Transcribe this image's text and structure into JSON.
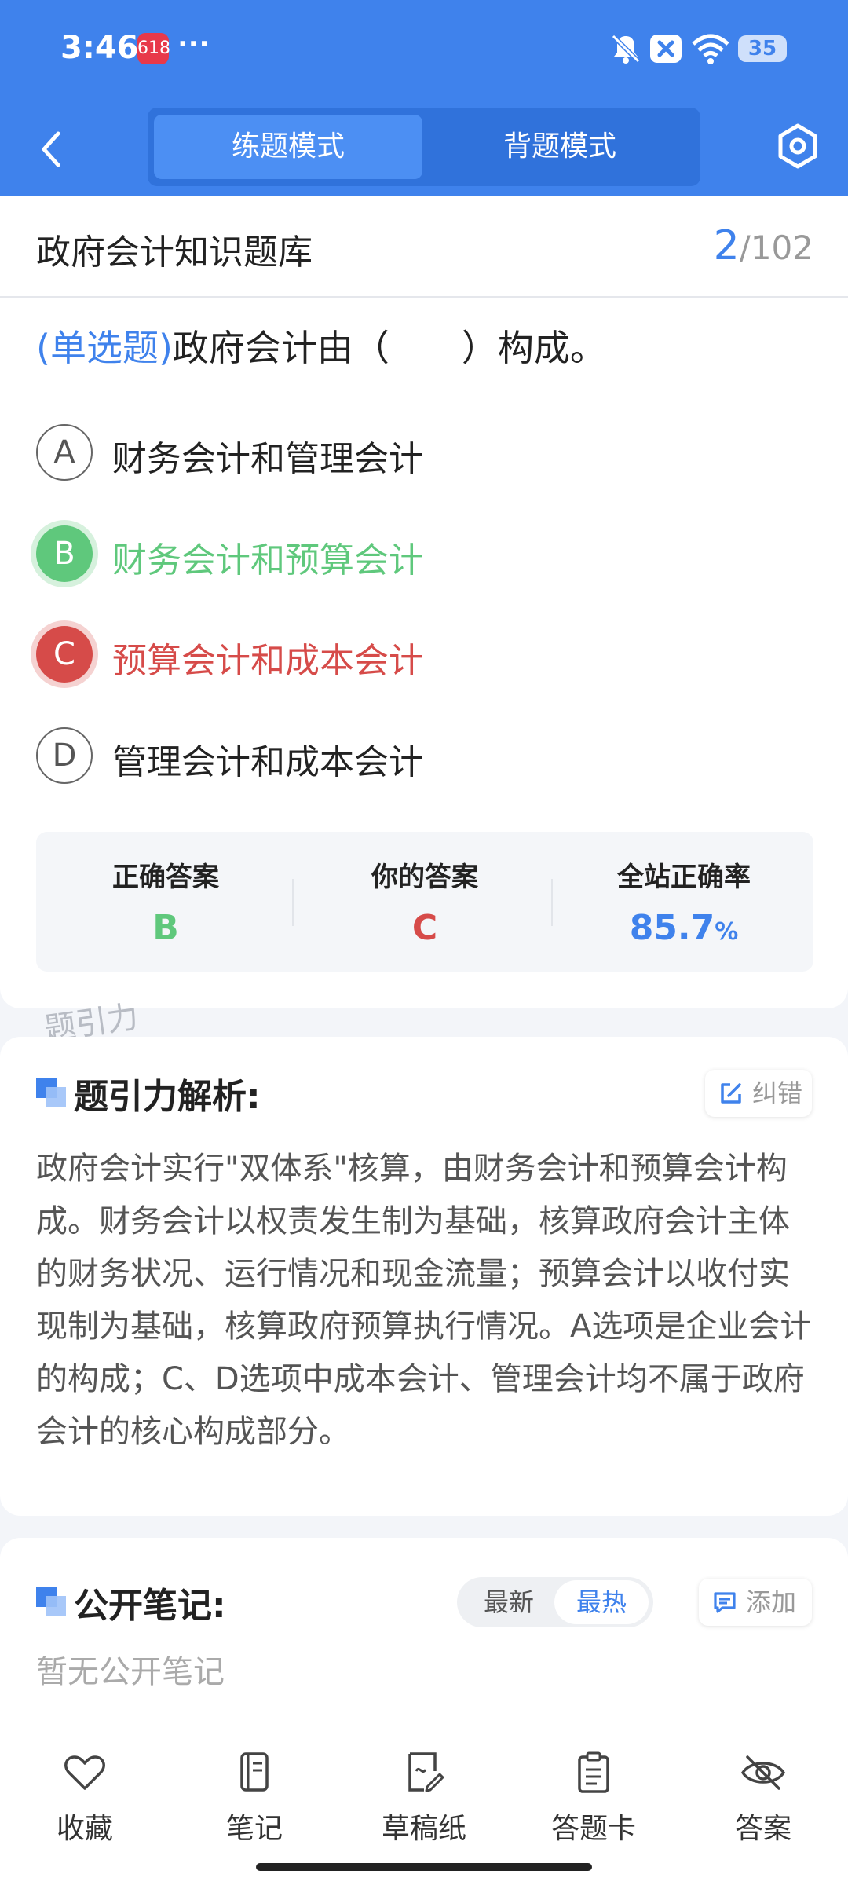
{
  "status": {
    "time": "3:46",
    "app_badge": "618",
    "dots": "···",
    "battery": "35"
  },
  "nav": {
    "tab_practice": "练题模式",
    "tab_memorize": "背题模式"
  },
  "header": {
    "bank_title": "政府会计知识题库",
    "current": "2",
    "total": "/102"
  },
  "question": {
    "type": "(单选题)",
    "text": "政府会计由（　　）构成。"
  },
  "options": [
    {
      "letter": "A",
      "text": "财务会计和管理会计",
      "state": "normal"
    },
    {
      "letter": "B",
      "text": "财务会计和预算会计",
      "state": "correct"
    },
    {
      "letter": "C",
      "text": "预算会计和成本会计",
      "state": "wrong"
    },
    {
      "letter": "D",
      "text": "管理会计和成本会计",
      "state": "normal"
    }
  ],
  "stats": {
    "correct_label": "正确答案",
    "correct_value": "B",
    "yours_label": "你的答案",
    "yours_value": "C",
    "rate_label": "全站正确率",
    "rate_value": "85.7",
    "rate_unit": "%"
  },
  "watermark": "题引力",
  "analysis": {
    "title": "题引力解析:",
    "report_label": "纠错",
    "text": "政府会计实行\"双体系\"核算，由财务会计和预算会计构成。财务会计以权责发生制为基础，核算政府会计主体的财务状况、运行情况和现金流量；预算会计以收付实现制为基础，核算政府预算执行情况。A选项是企业会计的构成；C、D选项中成本会计、管理会计均不属于政府会计的核心构成部分。"
  },
  "notes": {
    "title": "公开笔记:",
    "sort_newest": "最新",
    "sort_hottest": "最热",
    "add_label": "添加",
    "empty": "暂无公开笔记"
  },
  "bottom": {
    "favorite": "收藏",
    "note": "笔记",
    "draft": "草稿纸",
    "answer_card": "答题卡",
    "answer": "答案"
  },
  "colors": {
    "primary": "#3f82ec",
    "correct": "#5fc87c",
    "wrong": "#d64b49"
  }
}
